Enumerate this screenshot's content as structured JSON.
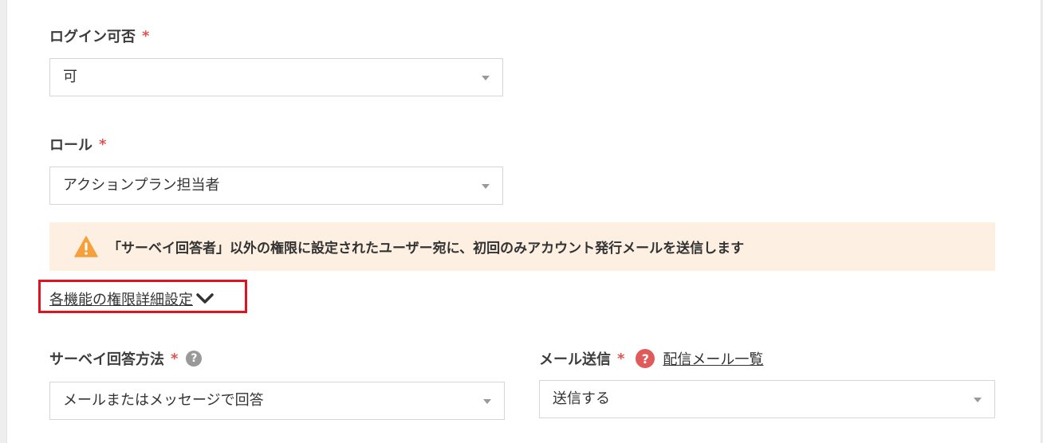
{
  "login": {
    "label": "ログイン可否",
    "required": "*",
    "value": "可"
  },
  "role": {
    "label": "ロール",
    "required": "*",
    "value": "アクションプラン担当者"
  },
  "notice": {
    "text": "「サーベイ回答者」以外の権限に設定されたユーザー宛に、初回のみアカウント発行メールを送信します",
    "icon": "warning-icon",
    "background": "#fdf0e2",
    "icon_color": "#f5a03a"
  },
  "advanced": {
    "label": "各機能の権限詳細設定",
    "icon": "chevron-down-icon",
    "highlight_color": "#e0141e"
  },
  "survey_method": {
    "label": "サーベイ回答方法",
    "required": "*",
    "help": "?",
    "value": "メールまたはメッセージで回答"
  },
  "mail_send": {
    "label": "メール送信",
    "required": "*",
    "help": "?",
    "link": "配信メール一覧",
    "value": "送信する"
  },
  "colors": {
    "required": "#e05353",
    "help_grey": "#999999",
    "help_red": "#e05a5a"
  }
}
